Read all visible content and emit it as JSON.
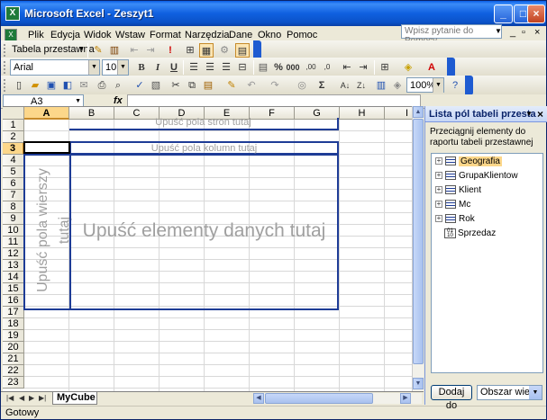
{
  "window": {
    "title": "Microsoft Excel - Zeszyt1"
  },
  "menu": {
    "items": [
      "Plik",
      "Edycja",
      "Widok",
      "Wstaw",
      "Format",
      "Narzędzia",
      "Dane",
      "Okno",
      "Pomoc"
    ],
    "ask_placeholder": "Wpisz pytanie do Pomocy"
  },
  "pivot_toolbar": {
    "label": "Tabela przestawna"
  },
  "format_toolbar": {
    "font": "Arial",
    "size": "10"
  },
  "standard_toolbar": {
    "zoom": "100%"
  },
  "formula_bar": {
    "name_box": "A3",
    "fx": "fx"
  },
  "columns": [
    "A",
    "B",
    "C",
    "D",
    "E",
    "F",
    "G",
    "H",
    "I"
  ],
  "rows": [
    "1",
    "2",
    "3",
    "4",
    "5",
    "6",
    "7",
    "8",
    "9",
    "10",
    "11",
    "12",
    "13",
    "14",
    "15",
    "16",
    "17",
    "18",
    "19",
    "20",
    "21",
    "22",
    "23"
  ],
  "pivot_drop": {
    "page": "Upuść pola stron tutaj",
    "column": "Upuść pola kolumn tutaj",
    "row": "Upuść pola wierszy tutaj",
    "data": "Upuść elementy danych tutaj"
  },
  "sheet_tab": "MyCube",
  "status": "Gotowy",
  "field_panel": {
    "title": "Lista pól tabeli przesta",
    "description": "Przeciągnij elementy do raportu tabeli przestawnej",
    "fields": [
      {
        "name": "Geografia",
        "type": "dimension",
        "selected": true
      },
      {
        "name": "GrupaKlientow",
        "type": "dimension",
        "selected": false
      },
      {
        "name": "Klient",
        "type": "dimension",
        "selected": false
      },
      {
        "name": "Mc",
        "type": "dimension",
        "selected": false
      },
      {
        "name": "Rok",
        "type": "dimension",
        "selected": false
      },
      {
        "name": "Sprzedaz",
        "type": "measure",
        "selected": false
      }
    ],
    "add_button": "Dodaj do",
    "area_select": "Obszar wiersz"
  }
}
